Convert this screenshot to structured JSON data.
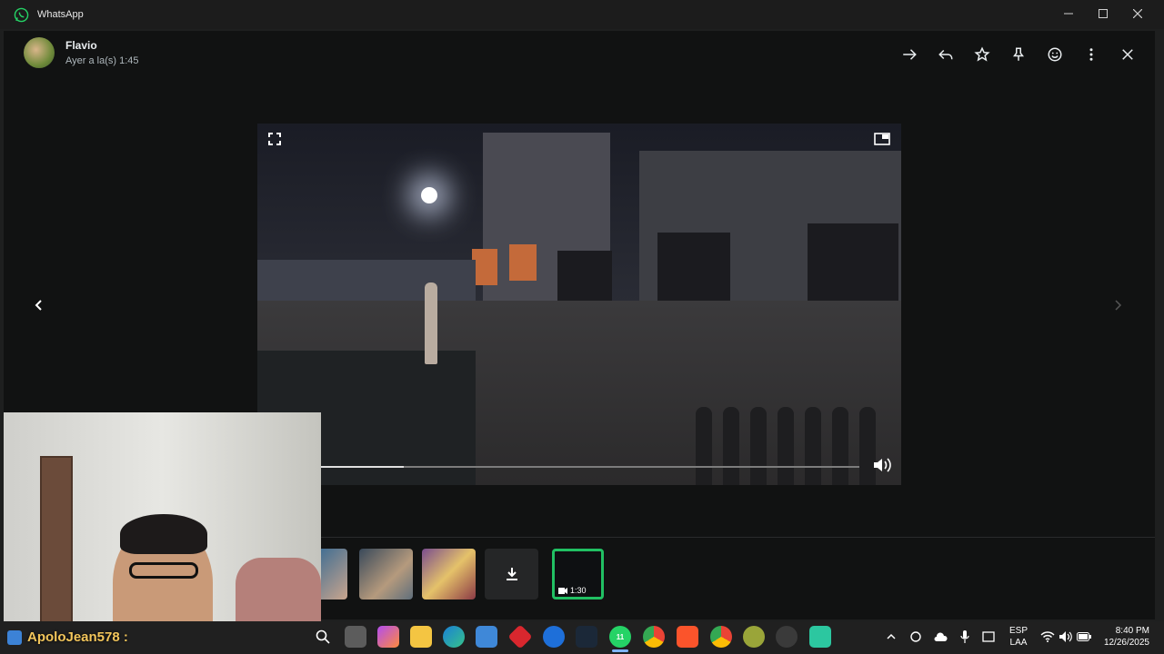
{
  "window": {
    "title": "WhatsApp",
    "minimize_icon": "minimize-icon",
    "maximize_icon": "maximize-icon",
    "close_icon": "close-icon"
  },
  "header": {
    "contact_name": "Flavio",
    "timestamp": "Ayer a la(s) 1:45",
    "actions": [
      "forward-icon",
      "reply-icon",
      "star-icon",
      "pin-icon",
      "emoji-icon",
      "more-icon",
      "close-icon"
    ]
  },
  "video": {
    "progress": 0.16,
    "fullscreen_icon": "fullscreen-icon",
    "pip_icon": "picture-in-picture-icon",
    "volume_icon": "volume-icon"
  },
  "thumbnails": [
    {
      "kind": "image"
    },
    {
      "kind": "image"
    },
    {
      "kind": "image"
    },
    {
      "kind": "download"
    },
    {
      "kind": "video",
      "duration": "1:30",
      "active": true
    }
  ],
  "overlay": {
    "streamer": "ApoloJean578 :"
  },
  "taskbar": {
    "language_top": "ESP",
    "language_bottom": "LAA",
    "time": "8:40 PM",
    "date": "12/26/2025",
    "whatsapp_badge": "11",
    "accent": "#21c063"
  }
}
